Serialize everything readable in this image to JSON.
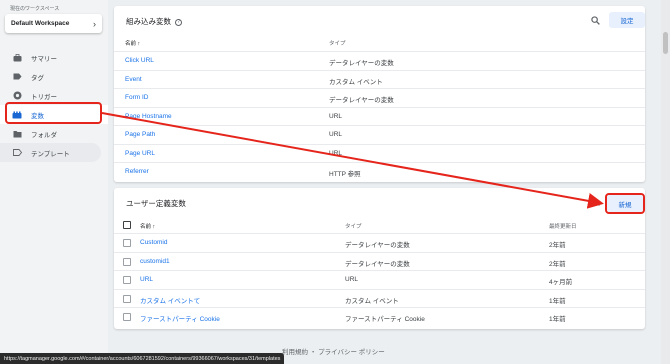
{
  "sidebar": {
    "workspace_label": "現在のワークスペース",
    "workspace_name": "Default Workspace",
    "items": [
      {
        "label": "サマリー",
        "icon": "briefcase-icon"
      },
      {
        "label": "タグ",
        "icon": "tag-icon"
      },
      {
        "label": "トリガー",
        "icon": "trigger-icon"
      },
      {
        "label": "変数",
        "icon": "variables-icon"
      },
      {
        "label": "フォルダ",
        "icon": "folder-icon"
      },
      {
        "label": "テンプレート",
        "icon": "template-icon"
      }
    ]
  },
  "builtin": {
    "title": "組み込み変数",
    "settings_label": "設定",
    "col_name": "名前",
    "col_type": "タイプ",
    "rows": [
      {
        "name": "Click URL",
        "type": "データレイヤーの変数"
      },
      {
        "name": "Event",
        "type": "カスタム イベント"
      },
      {
        "name": "Form ID",
        "type": "データレイヤーの変数"
      },
      {
        "name": "Page Hostname",
        "type": "URL"
      },
      {
        "name": "Page Path",
        "type": "URL"
      },
      {
        "name": "Page URL",
        "type": "URL"
      },
      {
        "name": "Referrer",
        "type": "HTTP 参照"
      }
    ]
  },
  "user": {
    "title": "ユーザー定義変数",
    "new_label": "新規",
    "col_name": "名前",
    "col_type": "タイプ",
    "col_updated": "最終更新日",
    "rows": [
      {
        "name": "Customid",
        "type": "データレイヤーの変数",
        "updated": "2年前"
      },
      {
        "name": "customid1",
        "type": "データレイヤーの変数",
        "updated": "2年前"
      },
      {
        "name": "URL",
        "type": "URL",
        "updated": "4ヶ月前"
      },
      {
        "name": "カスタム イベントて",
        "type": "カスタム イベント",
        "updated": "1年前"
      },
      {
        "name": "ファーストパーティ Cookie",
        "type": "ファーストパーティ Cookie",
        "updated": "1年前"
      }
    ]
  },
  "footer": {
    "terms": "利用規約",
    "sep": "・",
    "privacy": "プライバシー ポリシー"
  },
  "statusbar_url": "https://tagmanager.google.com/#/container/accounts/6067281592/containers/99366067/workspaces/31/templates",
  "colors": {
    "accent": "#1a73e8",
    "annotation": "#e5251b"
  }
}
